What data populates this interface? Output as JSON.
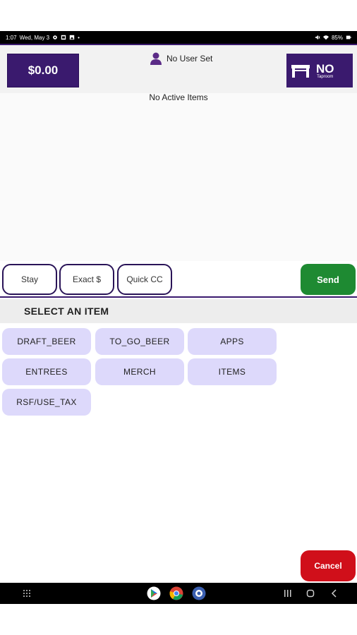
{
  "status_bar": {
    "time": "1:07",
    "date": "Wed, May 3",
    "battery": "85%"
  },
  "header": {
    "total": "$0.00",
    "user": "No User Set",
    "table_main": "NO",
    "table_sub": "Taproom"
  },
  "order": {
    "empty_text": "No Active Items"
  },
  "actions": {
    "stay": "Stay",
    "exact": "Exact $",
    "quick_cc": "Quick CC",
    "send": "Send"
  },
  "categories": {
    "title": "SELECT AN ITEM",
    "items": [
      "DRAFT_BEER",
      "TO_GO_BEER",
      "APPS",
      "ENTREES",
      "MERCH",
      "ITEMS",
      "RSF/USE_TAX"
    ]
  },
  "footer": {
    "cancel": "Cancel"
  },
  "colors": {
    "brand_purple": "#3a1a6e",
    "category_bg": "#ddd9fb",
    "send_green": "#1e8a32",
    "cancel_red": "#d00f1a"
  }
}
